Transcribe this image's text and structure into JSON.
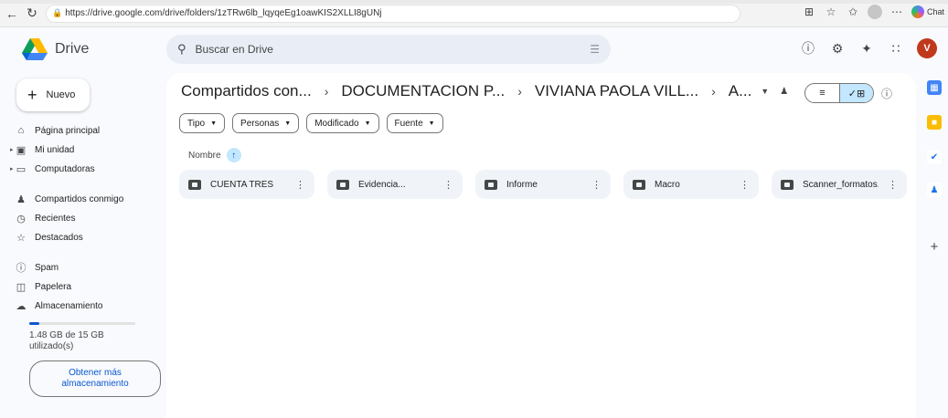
{
  "browser": {
    "url": "https://drive.google.com/drive/folders/1zTRw6lb_lqyqeEg1oawKIS2XLLI8gUNj",
    "chat_label": "Chat"
  },
  "header": {
    "app_title": "Drive",
    "search_placeholder": "Buscar en Drive",
    "user_initial": "V"
  },
  "sidebar": {
    "new_label": "Nuevo",
    "items": [
      {
        "label": "Página principal",
        "icon": "home-icon"
      },
      {
        "label": "Mi unidad",
        "icon": "my-drive-icon"
      },
      {
        "label": "Computadoras",
        "icon": "computer-icon"
      },
      {
        "label": "Compartidos conmigo",
        "icon": "shared-icon"
      },
      {
        "label": "Recientes",
        "icon": "clock-icon"
      },
      {
        "label": "Destacados",
        "icon": "star-icon"
      },
      {
        "label": "Spam",
        "icon": "spam-icon"
      },
      {
        "label": "Papelera",
        "icon": "trash-icon"
      },
      {
        "label": "Almacenamiento",
        "icon": "cloud-icon"
      }
    ],
    "storage_text": "1.48 GB de 15 GB utilizado(s)",
    "storage_used_fraction": 0.099,
    "more_storage_label": "Obtener más almacenamiento"
  },
  "main": {
    "breadcrumb": [
      "Compartidos con...",
      "DOCUMENTACION P...",
      "VIVIANA PAOLA VILL...",
      "A..."
    ],
    "filters": [
      "Tipo",
      "Personas",
      "Modificado",
      "Fuente"
    ],
    "sort_label": "Nombre",
    "folders": [
      "CUENTA TRES",
      "Evidencia...",
      "Informe",
      "Macro",
      "Scanner_formatos..."
    ]
  },
  "colors": {
    "accent": "#0b57d0",
    "selected_bg": "#c2e7ff",
    "avatar": "#c0391c"
  }
}
